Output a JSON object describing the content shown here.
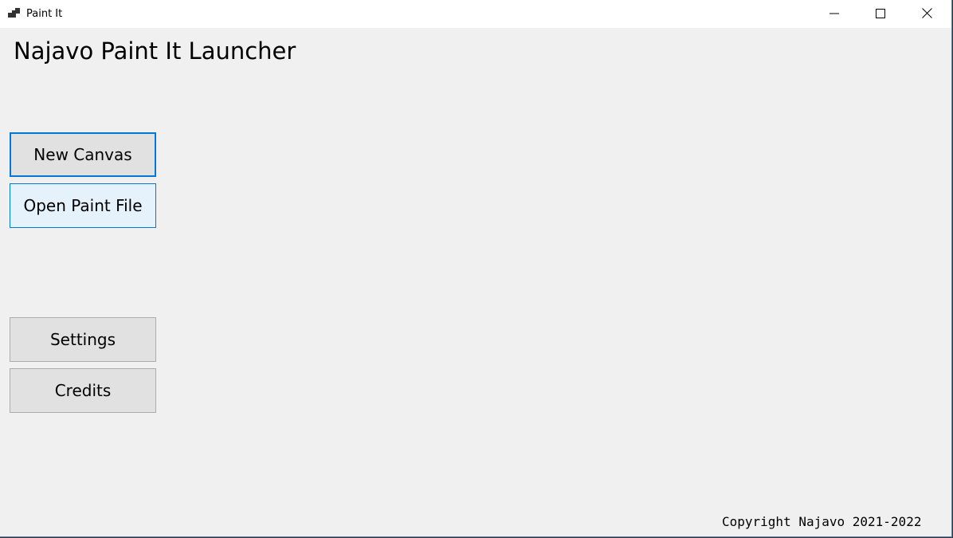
{
  "window": {
    "title": "Paint It",
    "icon": "paint-it-app-icon",
    "controls": {
      "minimize_icon": "minimize-icon",
      "maximize_icon": "maximize-icon",
      "close_icon": "close-icon"
    }
  },
  "main": {
    "heading": "Najavo Paint It Launcher",
    "buttons": {
      "new_canvas": "New Canvas",
      "open_paint_file": "Open Paint File",
      "settings": "Settings",
      "credits": "Credits"
    },
    "copyright": "Copyright Najavo 2021-2022"
  },
  "colors": {
    "window_background": "#f0f0f0",
    "titlebar_background": "#ffffff",
    "button_background": "#e1e1e1",
    "button_border": "#adadad",
    "focus_accent": "#0078d7",
    "hover_background": "#e5f1fb"
  }
}
